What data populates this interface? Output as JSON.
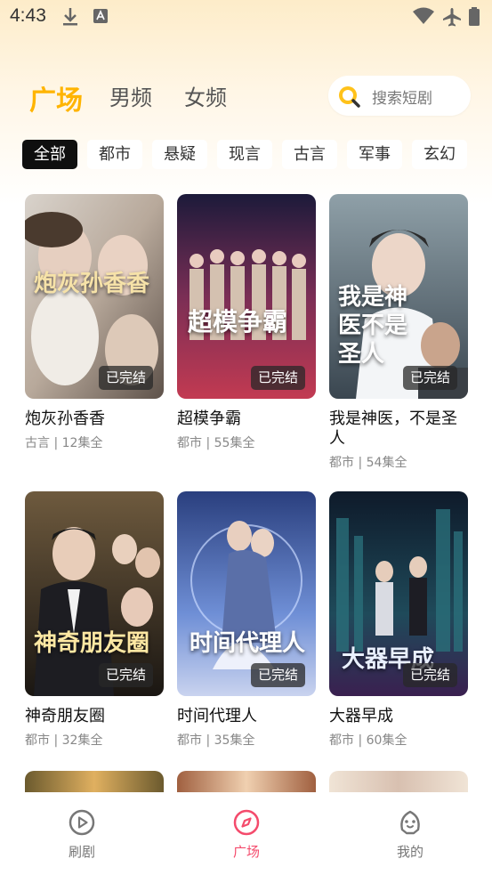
{
  "status_bar": {
    "time": "4:43"
  },
  "header": {
    "tabs": [
      {
        "label": "广场",
        "active": true
      },
      {
        "label": "男频",
        "active": false
      },
      {
        "label": "女频",
        "active": false
      }
    ],
    "search": {
      "placeholder": "搜索短剧"
    },
    "accent_color": "#ffb400"
  },
  "categories": [
    {
      "label": "全部",
      "active": true
    },
    {
      "label": "都市"
    },
    {
      "label": "悬疑"
    },
    {
      "label": "现言"
    },
    {
      "label": "古言"
    },
    {
      "label": "军事"
    },
    {
      "label": "玄幻"
    }
  ],
  "dramas": [
    {
      "title": "炮灰孙香香",
      "genre": "古言",
      "episodes": "12集全",
      "badge": "已完结",
      "poster_text": "炮灰孙香香",
      "colors": [
        "#d8cfc6",
        "#8a7a6c"
      ]
    },
    {
      "title": "超模争霸",
      "genre": "都市",
      "episodes": "55集全",
      "badge": "已完结",
      "poster_text": "超模争霸",
      "colors": [
        "#4a2140",
        "#b23a5e"
      ]
    },
    {
      "title": "我是神医，不是圣人",
      "genre": "都市",
      "episodes": "54集全",
      "badge": "已完结",
      "poster_text": "我是神医不是圣人",
      "colors": [
        "#6b7f8a",
        "#2d3a44"
      ]
    },
    {
      "title": "神奇朋友圈",
      "genre": "都市",
      "episodes": "32集全",
      "badge": "已完结",
      "poster_text": "神奇朋友圈",
      "colors": [
        "#5b4a33",
        "#1e1a16"
      ]
    },
    {
      "title": "时间代理人",
      "genre": "都市",
      "episodes": "35集全",
      "badge": "已完结",
      "poster_text": "时间代理人",
      "colors": [
        "#3b5fa8",
        "#a3b6e6"
      ]
    },
    {
      "title": "大器早成",
      "genre": "都市",
      "episodes": "60集全",
      "badge": "已完结",
      "poster_text": "大器早成",
      "colors": [
        "#1d3b4c",
        "#2b1d3e"
      ]
    }
  ],
  "meta_separator": "|",
  "bottom_nav": [
    {
      "label": "刷剧",
      "icon": "play-circle-icon",
      "active": false
    },
    {
      "label": "广场",
      "icon": "compass-icon",
      "active": true
    },
    {
      "label": "我的",
      "icon": "profile-icon",
      "active": false
    }
  ],
  "nav_active_color": "#f44b6c"
}
